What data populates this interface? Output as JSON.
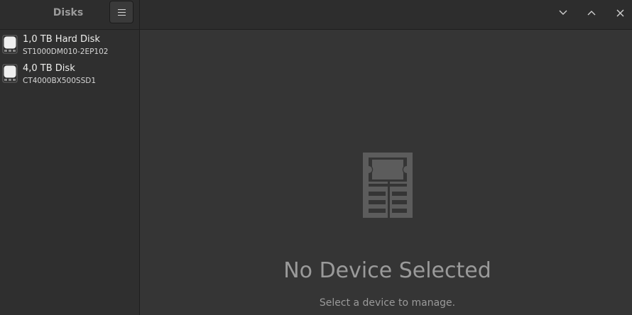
{
  "app": {
    "sidebar_title": "Disks"
  },
  "window_controls": {
    "minimize_icon": "chevron-down-icon",
    "maximize_icon": "chevron-up-icon",
    "close_icon": "close-icon"
  },
  "disks": [
    {
      "name": "1,0 TB Hard Disk",
      "model": "ST1000DM010-2EP102",
      "icon": "hard-disk-icon"
    },
    {
      "name": "4,0 TB Disk",
      "model": "CT4000BX500SSD1",
      "icon": "hard-disk-icon"
    }
  ],
  "empty_state": {
    "icon": "drive-icon",
    "title": "No Device Selected",
    "subtitle": "Select a device to manage."
  },
  "colors": {
    "background": "#353535",
    "sidebar": "#2f2f2f",
    "headerbar": "#2d2d2d",
    "muted_text": "#9a9a9a"
  }
}
